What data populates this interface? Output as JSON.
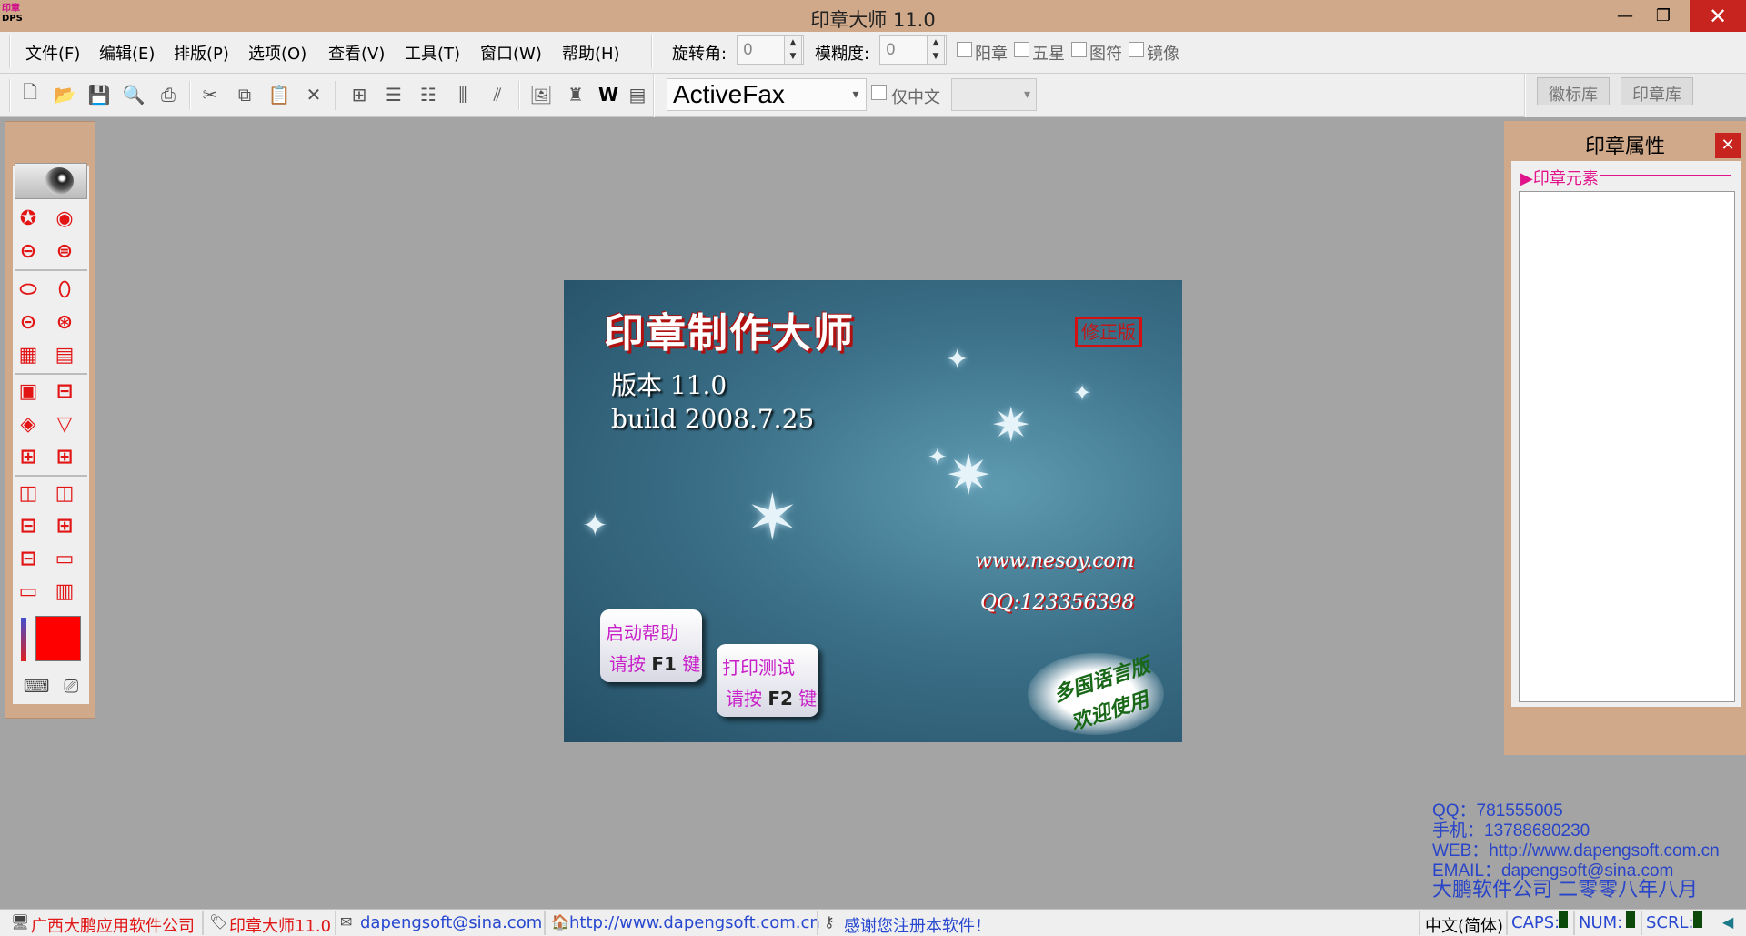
{
  "window": {
    "title": "印章大师 11.0",
    "icon_text_top": "印章",
    "icon_text_bottom": "DPS",
    "min_glyph": "—",
    "max_glyph": "❐",
    "close_glyph": "✕"
  },
  "menu": {
    "items": [
      "文件(F)",
      "编辑(E)",
      "排版(P)",
      "选项(O)",
      "查看(V)",
      "工具(T)",
      "窗口(W)",
      "帮助(H)"
    ]
  },
  "props": {
    "rotation_label": "旋转角:",
    "rotation_value": "0",
    "blur_label": "模糊度:",
    "blur_value": "0",
    "checkboxes": [
      "阳章",
      "五星",
      "图符",
      "镜像"
    ]
  },
  "toolbar": {
    "font_name": "ActiveFax",
    "chinese_only_label": "仅中文",
    "tabs": [
      "徽标库",
      "印章库"
    ]
  },
  "palette": {
    "color_hex": "#ff0000"
  },
  "splash": {
    "title": "印章制作大师",
    "badge": "修正版",
    "version": "版本 11.0",
    "build": "build 2008.7.25",
    "website": "www.nesoy.com",
    "qq": "QQ:123356398",
    "help_card_line1": "启动帮助",
    "help_card_line2_prefix": "请按",
    "help_card_key": "F1",
    "help_card_line2_suffix": "键",
    "print_card_line1": "打印测试",
    "print_card_line2_prefix": "请按",
    "print_card_key": "F2",
    "print_card_line2_suffix": "键",
    "multilang_line1": "多国语言版",
    "multilang_line2": "欢迎使用"
  },
  "properties_panel": {
    "title": "印章属性",
    "section": "印章元素",
    "close_glyph": "✕"
  },
  "contact": {
    "qq": "QQ：781555005",
    "mobile": "手机：13788680230",
    "web": "WEB：http://www.dapengsoft.com.cn",
    "email": "EMAIL：dapengsoft@sina.com",
    "company_date": "大鹏软件公司 二零零八年八月"
  },
  "statusbar": {
    "company": "广西大鹏应用软件公司",
    "product": "印章大师11.0",
    "email": "dapengsoft@sina.com",
    "website": "http://www.dapengsoft.com.cn",
    "thanks": "感谢您注册本软件！",
    "ime": "中文(简体)",
    "caps": "CAPS:",
    "num": "NUM:",
    "scrl": "SCRL:"
  }
}
